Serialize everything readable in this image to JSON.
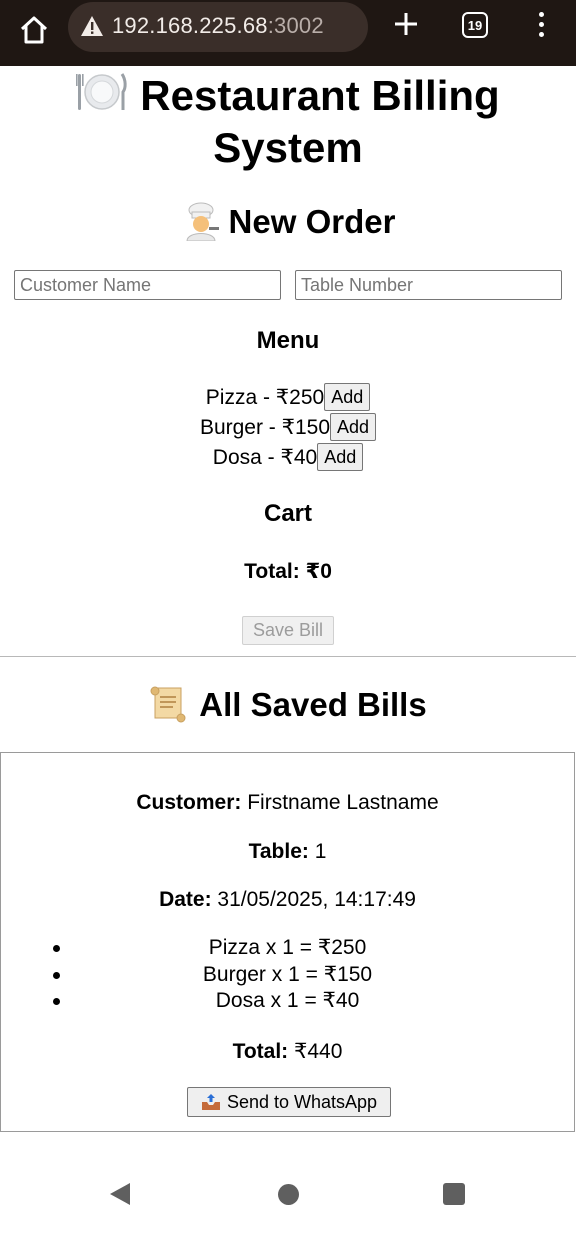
{
  "browser": {
    "url_host": "192.168.225.68",
    "url_port": ":3002",
    "tab_count": "19"
  },
  "page": {
    "title_line1": "Restaurant Billing",
    "title_line2": "System"
  },
  "new_order": {
    "heading": "New Order",
    "customer_placeholder": "Customer Name",
    "table_placeholder": "Table Number",
    "menu_heading": "Menu",
    "menu_items": [
      {
        "label": "Pizza - ₹250",
        "button": "Add"
      },
      {
        "label": "Burger - ₹150",
        "button": "Add"
      },
      {
        "label": "Dosa - ₹40",
        "button": "Add"
      }
    ],
    "cart_heading": "Cart",
    "total_label": "Total:",
    "total_value": "₹0",
    "save_button": "Save Bill"
  },
  "saved_bills": {
    "heading": "All Saved Bills",
    "bills": [
      {
        "customer_label": "Customer:",
        "customer_value": "Firstname Lastname",
        "table_label": "Table:",
        "table_value": "1",
        "date_label": "Date:",
        "date_value": "31/05/2025, 14:17:49",
        "items": [
          "Pizza x 1 = ₹250",
          "Burger x 1 = ₹150",
          "Dosa x 1 = ₹40"
        ],
        "total_label": "Total:",
        "total_value": "₹440",
        "whatsapp_button": "Send to WhatsApp"
      }
    ]
  },
  "colors": {
    "browser_bar": "#1f1713",
    "url_box": "#3a2e29"
  }
}
